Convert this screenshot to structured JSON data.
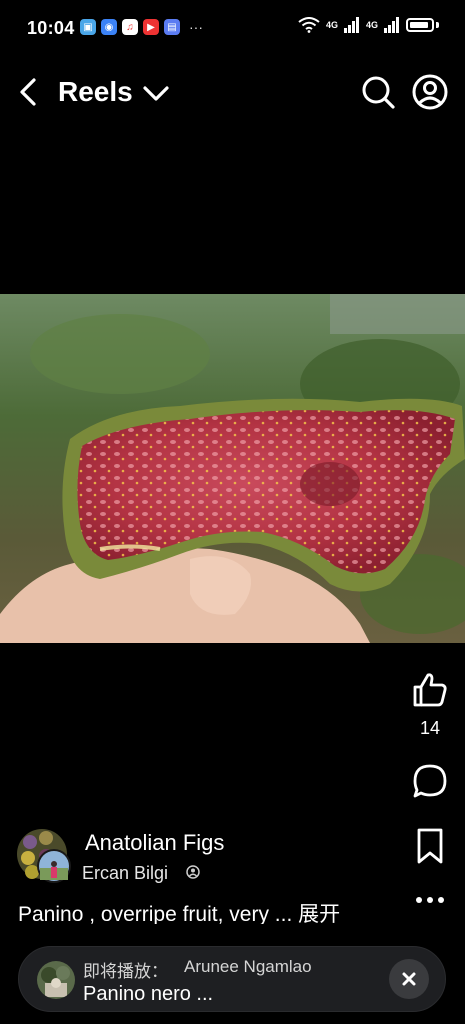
{
  "status_bar": {
    "time": "10:04",
    "more": "···",
    "network_1": "4G",
    "network_2": "4G",
    "wifi_label": "6"
  },
  "header": {
    "title": "Reels"
  },
  "actions": {
    "like_count": "14"
  },
  "post": {
    "page_name": "Anatolian Figs",
    "author": "Ercan Bilgi",
    "caption_text": "Panino , overripe fruit, very ... ",
    "caption_expand": "展开"
  },
  "up_next": {
    "label": "即将播放：",
    "author": "Arunee Ngamlao",
    "title": "Panino nero ..."
  },
  "colors": {
    "background": "#000000",
    "up_next_bg": "#1e1f22",
    "close_bg": "#3a3b3e"
  }
}
